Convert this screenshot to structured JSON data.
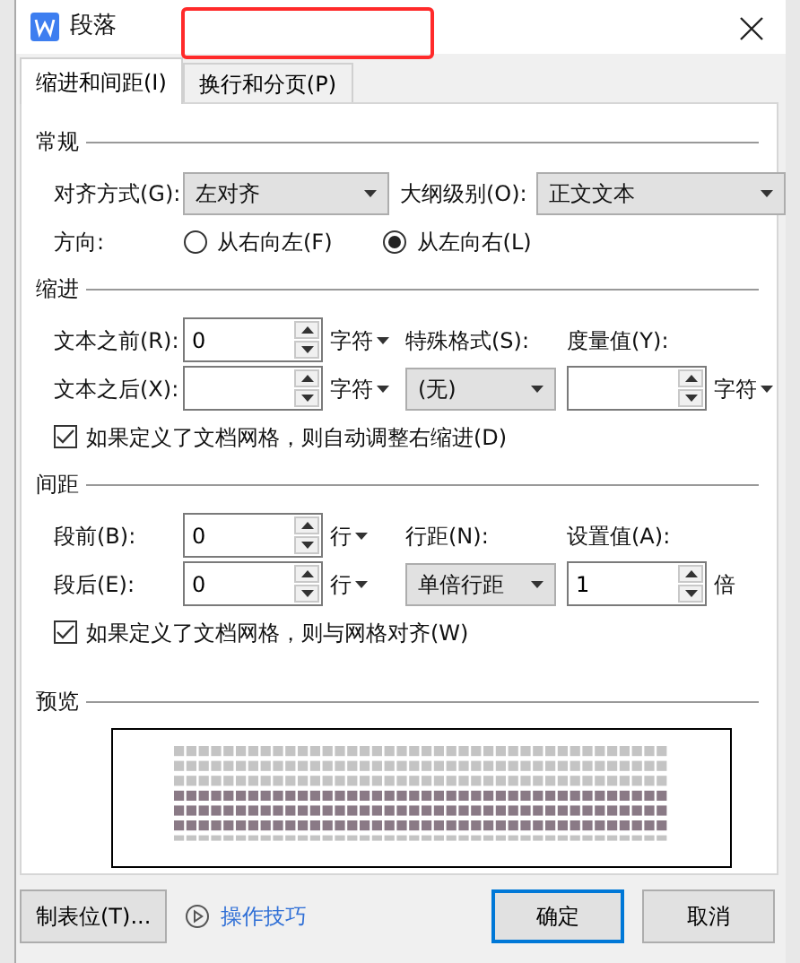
{
  "window": {
    "title": "段落"
  },
  "tabs": [
    {
      "label": "缩进和间距(I)",
      "selected": true
    },
    {
      "label": "换行和分页(P)",
      "selected": false
    }
  ],
  "highlight": {
    "kind": "rectangle",
    "color": "#ff2a2a"
  },
  "general": {
    "heading": "常规",
    "alignment": {
      "label": "对齐方式(G):",
      "value": "左对齐"
    },
    "outline": {
      "label": "大纲级别(O):",
      "value": "正文文本"
    },
    "direction": {
      "label": "方向:",
      "options": [
        {
          "label": "从右向左(F)",
          "selected": false
        },
        {
          "label": "从左向右(L)",
          "selected": true
        }
      ]
    }
  },
  "indent": {
    "heading": "缩进",
    "before": {
      "label": "文本之前(R):",
      "value": "0",
      "unit": "字符"
    },
    "after": {
      "label": "文本之后(X):",
      "unit": "字符"
    },
    "special": {
      "label": "特殊格式(S):",
      "value": "(无)"
    },
    "by": {
      "label": "度量值(Y):",
      "unit": "字符"
    },
    "grid_check": {
      "label": "如果定义了文档网格，则自动调整右缩进(D)",
      "checked": true
    }
  },
  "spacing": {
    "heading": "间距",
    "before": {
      "label": "段前(B):",
      "value": "0",
      "unit": "行"
    },
    "after": {
      "label": "段后(E):",
      "value": "0",
      "unit": "行"
    },
    "line": {
      "label": "行距(N):",
      "value": "单倍行距"
    },
    "at": {
      "label": "设置值(A):",
      "value": "1",
      "unit": "倍"
    },
    "grid_check": {
      "label": "如果定义了文档网格，则与网格对齐(W)",
      "checked": true
    }
  },
  "preview": {
    "heading": "预览"
  },
  "footer": {
    "tabs_button": "制表位(T)...",
    "tips_link": "操作技巧",
    "ok": "确定",
    "cancel": "取消"
  }
}
